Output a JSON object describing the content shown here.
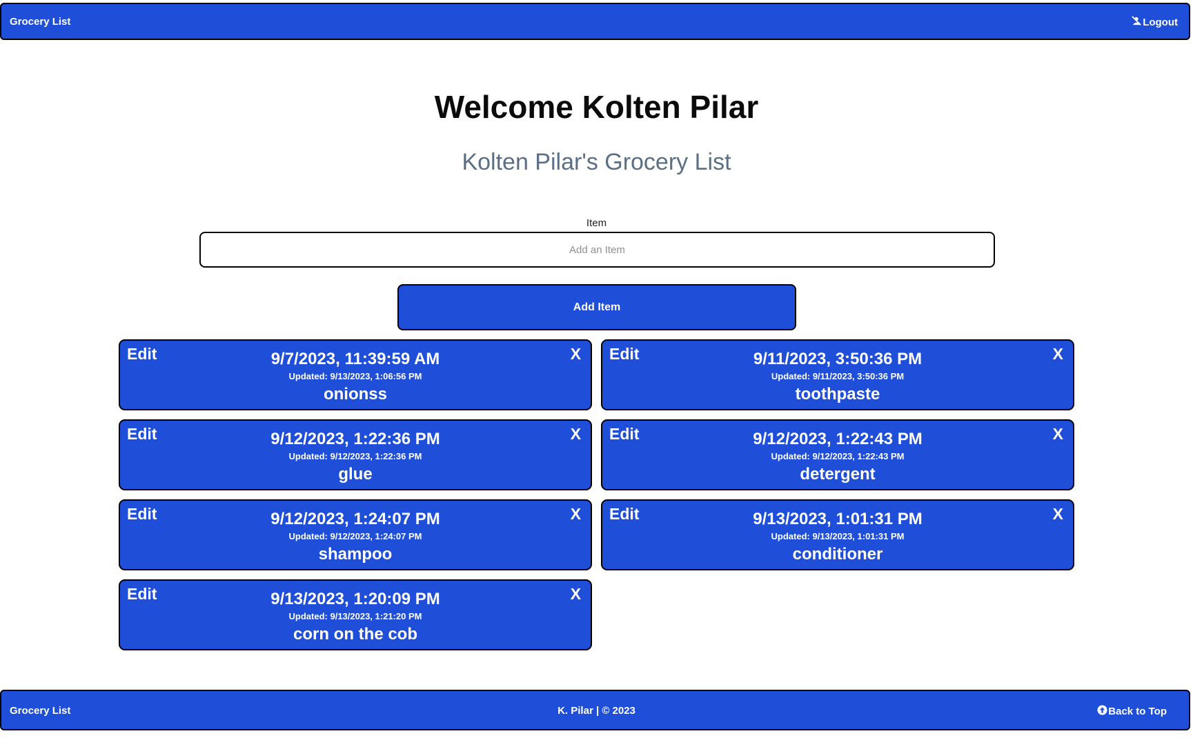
{
  "navbar": {
    "brand": "Grocery List",
    "logout_label": "Logout",
    "logout_icon": "user-slash-icon"
  },
  "header": {
    "title": "Welcome Kolten Pilar",
    "subtitle": "Kolten Pilar's Grocery List"
  },
  "form": {
    "item_label": "Item",
    "item_placeholder": "Add an Item",
    "item_value": "",
    "add_button_label": "Add Item"
  },
  "items": [
    {
      "edit": "Edit",
      "remove": "X",
      "created": "9/7/2023, 11:39:59 AM",
      "updated": "Updated: 9/13/2023, 1:06:56 PM",
      "name": "onionss"
    },
    {
      "edit": "Edit",
      "remove": "X",
      "created": "9/11/2023, 3:50:36 PM",
      "updated": "Updated: 9/11/2023, 3:50:36 PM",
      "name": "toothpaste"
    },
    {
      "edit": "Edit",
      "remove": "X",
      "created": "9/12/2023, 1:22:36 PM",
      "updated": "Updated: 9/12/2023, 1:22:36 PM",
      "name": "glue"
    },
    {
      "edit": "Edit",
      "remove": "X",
      "created": "9/12/2023, 1:22:43 PM",
      "updated": "Updated: 9/12/2023, 1:22:43 PM",
      "name": "detergent"
    },
    {
      "edit": "Edit",
      "remove": "X",
      "created": "9/12/2023, 1:24:07 PM",
      "updated": "Updated: 9/12/2023, 1:24:07 PM",
      "name": "shampoo"
    },
    {
      "edit": "Edit",
      "remove": "X",
      "created": "9/13/2023, 1:01:31 PM",
      "updated": "Updated: 9/13/2023, 1:01:31 PM",
      "name": "conditioner"
    },
    {
      "edit": "Edit",
      "remove": "X",
      "created": "9/13/2023, 1:20:09 PM",
      "updated": "Updated: 9/13/2023, 1:21:20 PM",
      "name": "corn on the cob"
    }
  ],
  "footer": {
    "brand": "Grocery List",
    "copyright": "K. Pilar | © 2023",
    "back_to_top": "Back to Top",
    "back_to_top_icon": "arrow-up-circle-icon"
  },
  "colors": {
    "primary": "#1f4fd8",
    "border": "#000000",
    "subtitle": "#5b6f84"
  }
}
